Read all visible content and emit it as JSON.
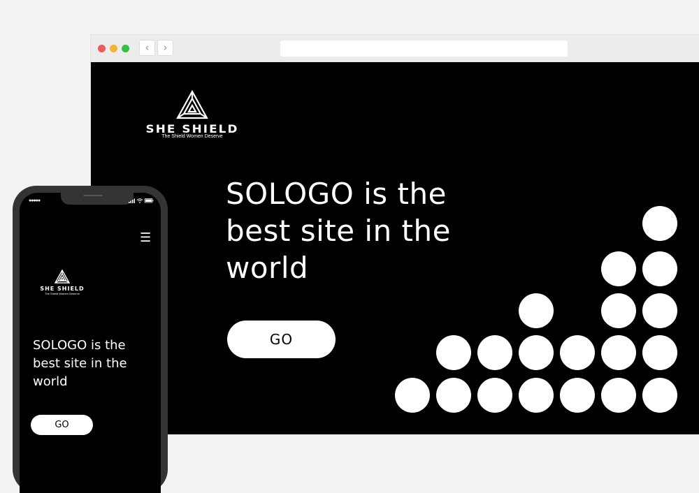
{
  "colors": {
    "page_bg": "#f3f3f3",
    "site_bg": "#000000",
    "accent": "#ffffff",
    "traffic_red": "#ee5a57",
    "traffic_yellow": "#f2b62c",
    "traffic_green": "#2fc33f"
  },
  "browser": {
    "back_icon": "chevron-left-icon",
    "forward_icon": "chevron-right-icon",
    "back_glyph": "‹",
    "forward_glyph": "›",
    "address_value": ""
  },
  "brand": {
    "name": "SHE SHIELD",
    "tagline": "The Shield Women Deserve",
    "logo_icon": "triangle-knot-logo"
  },
  "hero": {
    "headline": "SOLOGO is the best site in the world",
    "cta_label": "GO"
  },
  "mobile": {
    "menu_icon": "hamburger-icon",
    "menu_glyph": "☰",
    "signal_glyph": "●●●●●",
    "headline": "SOLOGO is the best site in the world",
    "cta_label": "GO"
  }
}
